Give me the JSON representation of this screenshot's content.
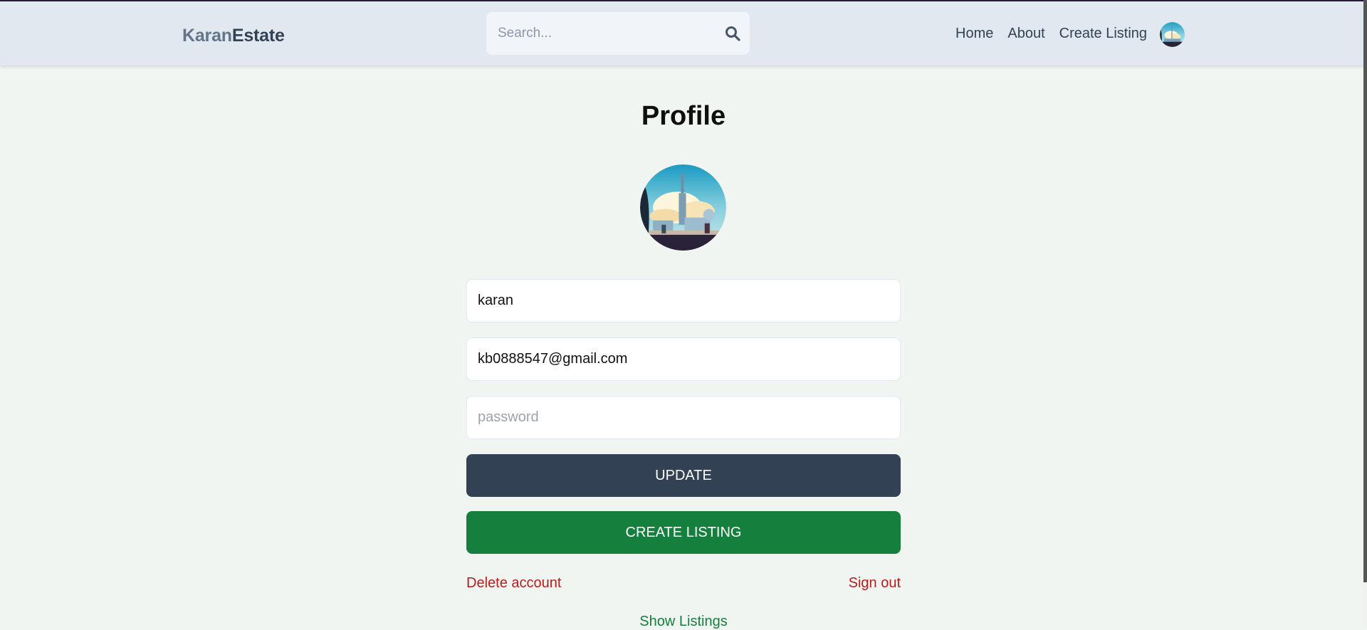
{
  "header": {
    "logo_part1": "Karan",
    "logo_part2": "Estate",
    "search_placeholder": "Search...",
    "nav": [
      {
        "label": "Home"
      },
      {
        "label": "About"
      },
      {
        "label": "Create Listing"
      }
    ]
  },
  "profile": {
    "title": "Profile",
    "username": "karan",
    "email": "kb0888547@gmail.com",
    "password_placeholder": "password",
    "update_label": "UPDATE",
    "create_listing_label": "CREATE LISTING",
    "delete_account_label": "Delete account",
    "sign_out_label": "Sign out",
    "show_listings_label": "Show Listings"
  },
  "colors": {
    "header_bg": "#e2e8f0",
    "page_bg": "#f1f5f1",
    "update_bg": "#334155",
    "create_bg": "#15803d",
    "danger": "#b91c1c"
  }
}
